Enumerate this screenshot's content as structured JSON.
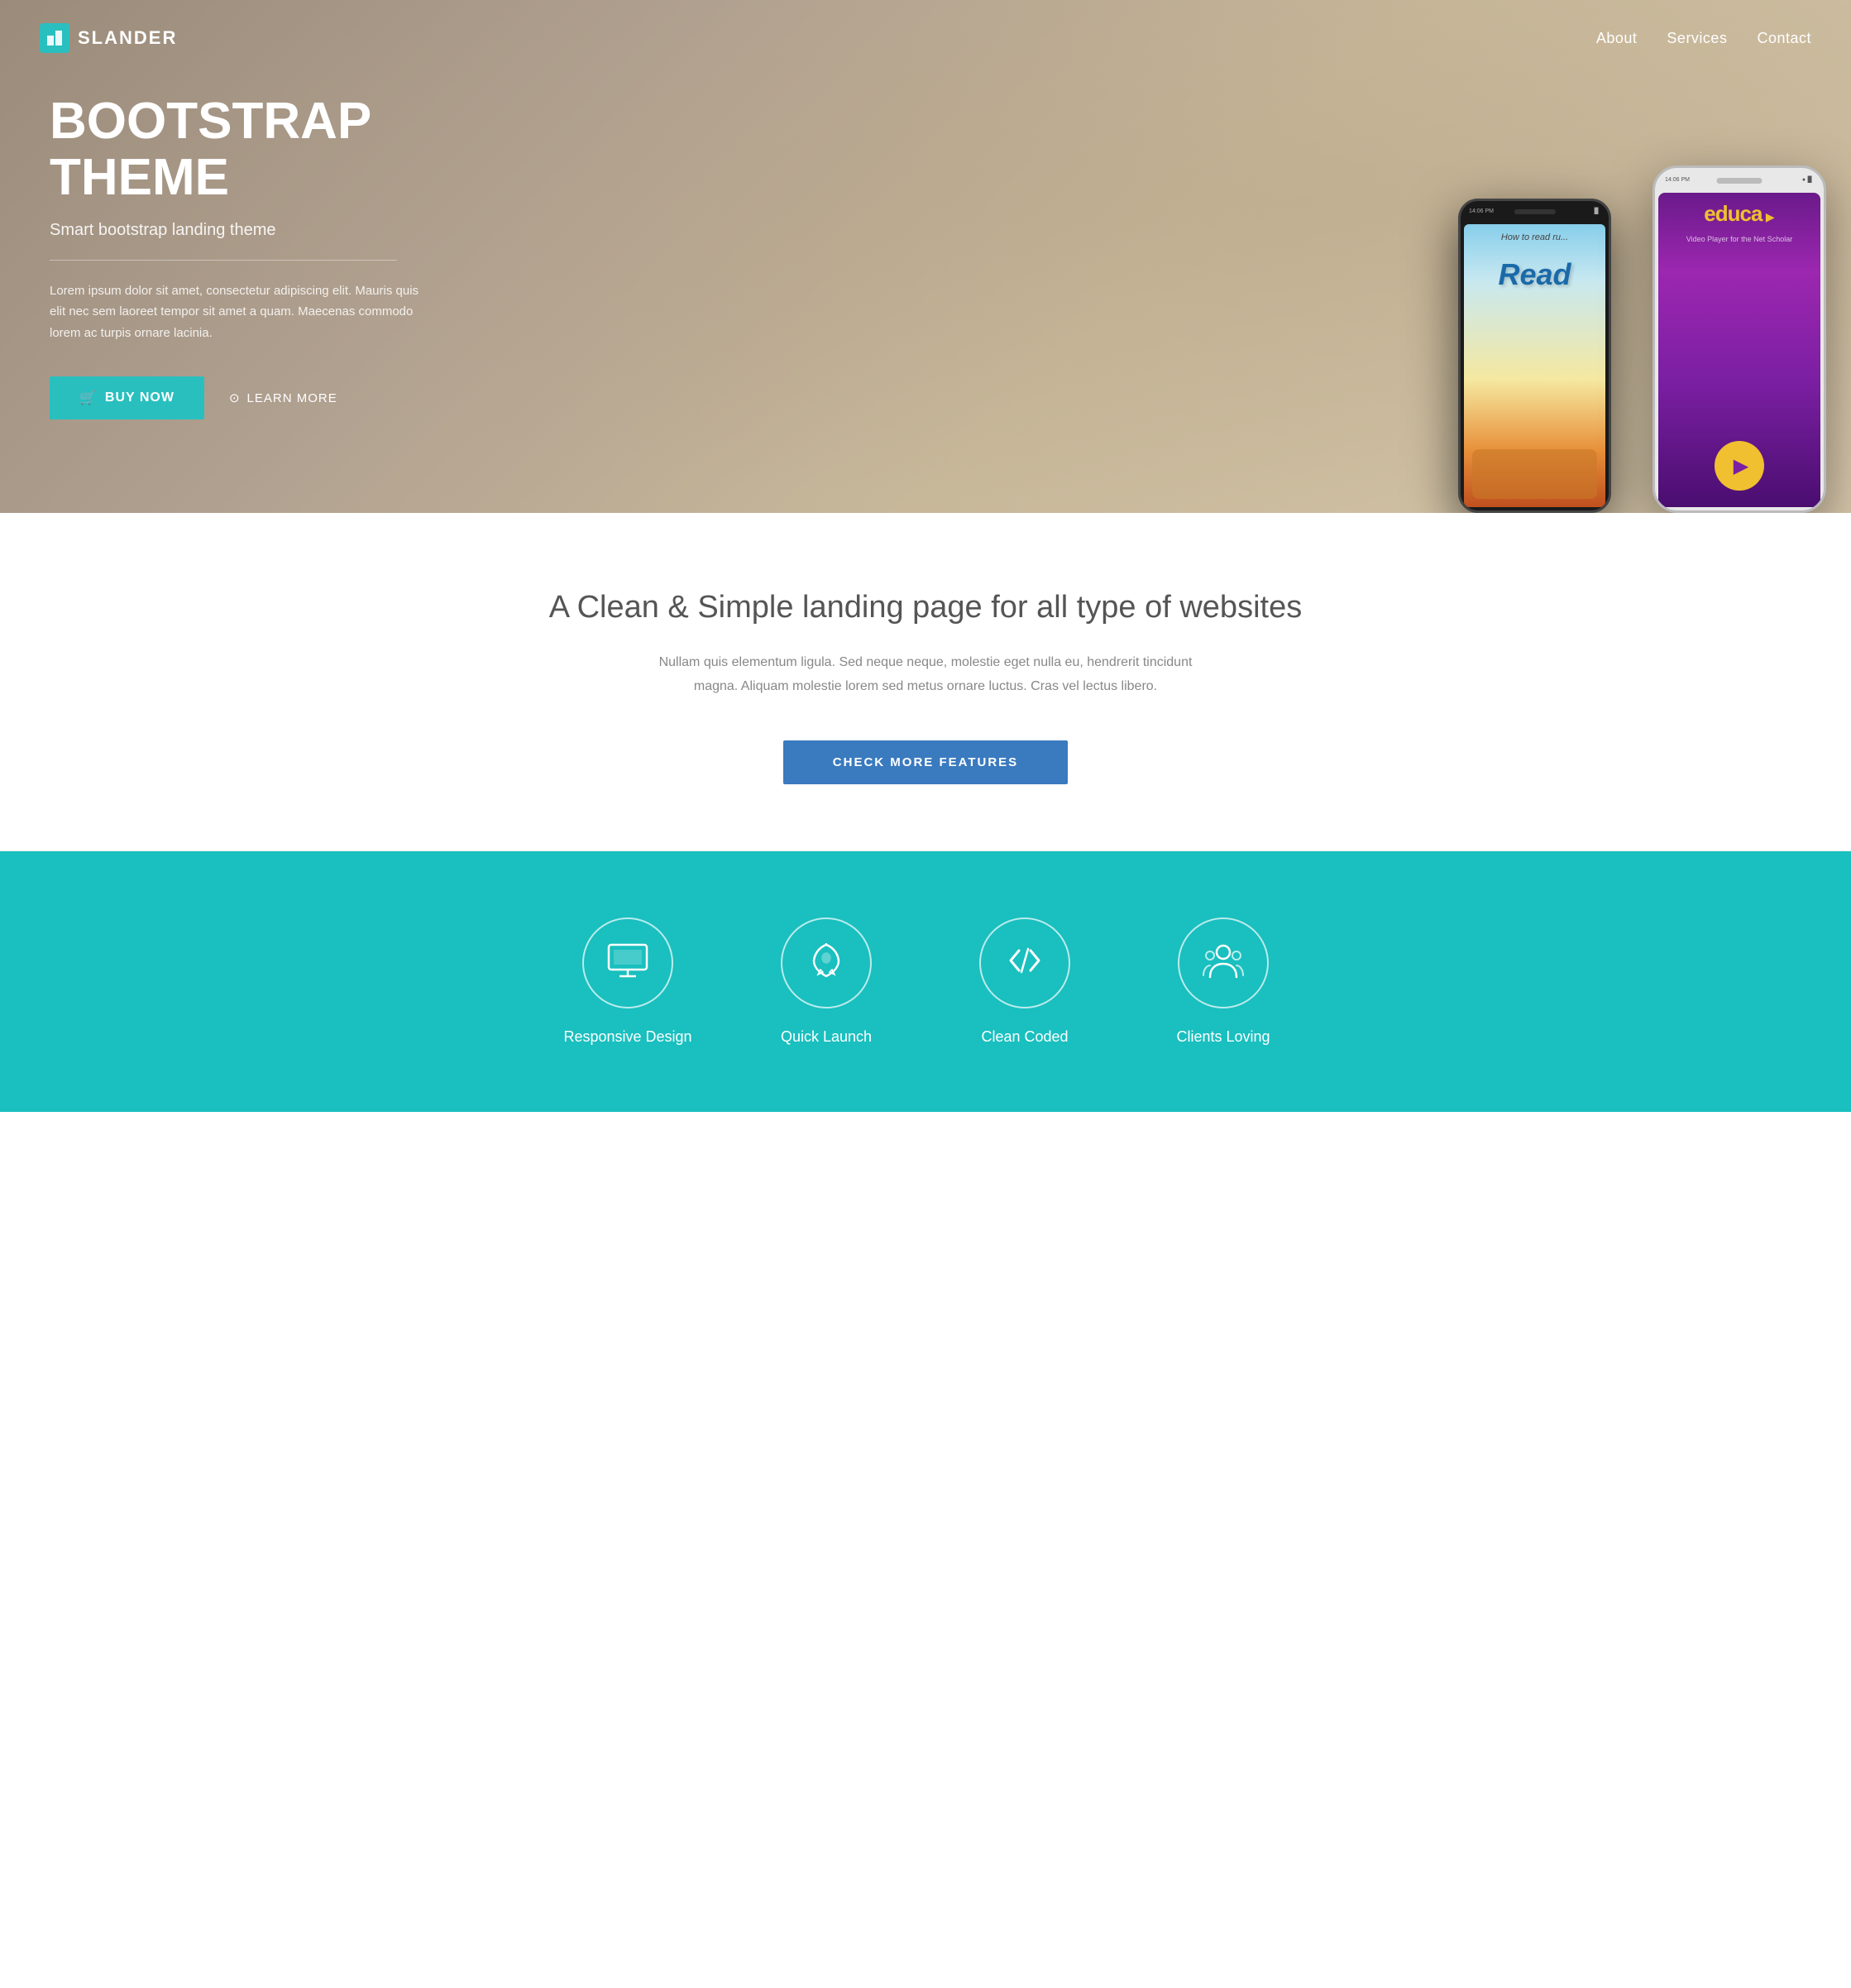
{
  "nav": {
    "logo_text": "SLANDER",
    "logo_icon": "S",
    "links": [
      {
        "label": "About",
        "href": "#about"
      },
      {
        "label": "Services",
        "href": "#services"
      },
      {
        "label": "Contact",
        "href": "#contact"
      }
    ]
  },
  "hero": {
    "title": "BOOTSTRAP THEME",
    "subtitle": "Smart bootstrap landing theme",
    "description": "Lorem ipsum dolor sit amet, consectetur adipiscing elit. Mauris quis elit nec sem laoreet tempor sit amet a quam. Maecenas commodo lorem ac turpis ornare lacinia.",
    "btn_buy": "BUY NOW",
    "btn_learn": "LEARN MORE"
  },
  "middle": {
    "title": "A Clean & Simple landing page for all type of websites",
    "description": "Nullam quis elementum ligula. Sed neque neque, molestie eget nulla eu, hendrerit tincidunt magna. Aliquam molestie lorem sed metus ornare luctus. Cras vel lectus libero.",
    "btn_check": "CHECK MORE FEATURES"
  },
  "features": {
    "items": [
      {
        "label": "Responsive Design",
        "icon": "monitor"
      },
      {
        "label": "Quick Launch",
        "icon": "rocket"
      },
      {
        "label": "Clean Coded",
        "icon": "code"
      },
      {
        "label": "Clients Loving",
        "icon": "users"
      }
    ]
  },
  "colors": {
    "teal": "#1abfbf",
    "blue": "#3a7abf",
    "dark": "#333333",
    "hero_bg": "#9b8b7a"
  }
}
